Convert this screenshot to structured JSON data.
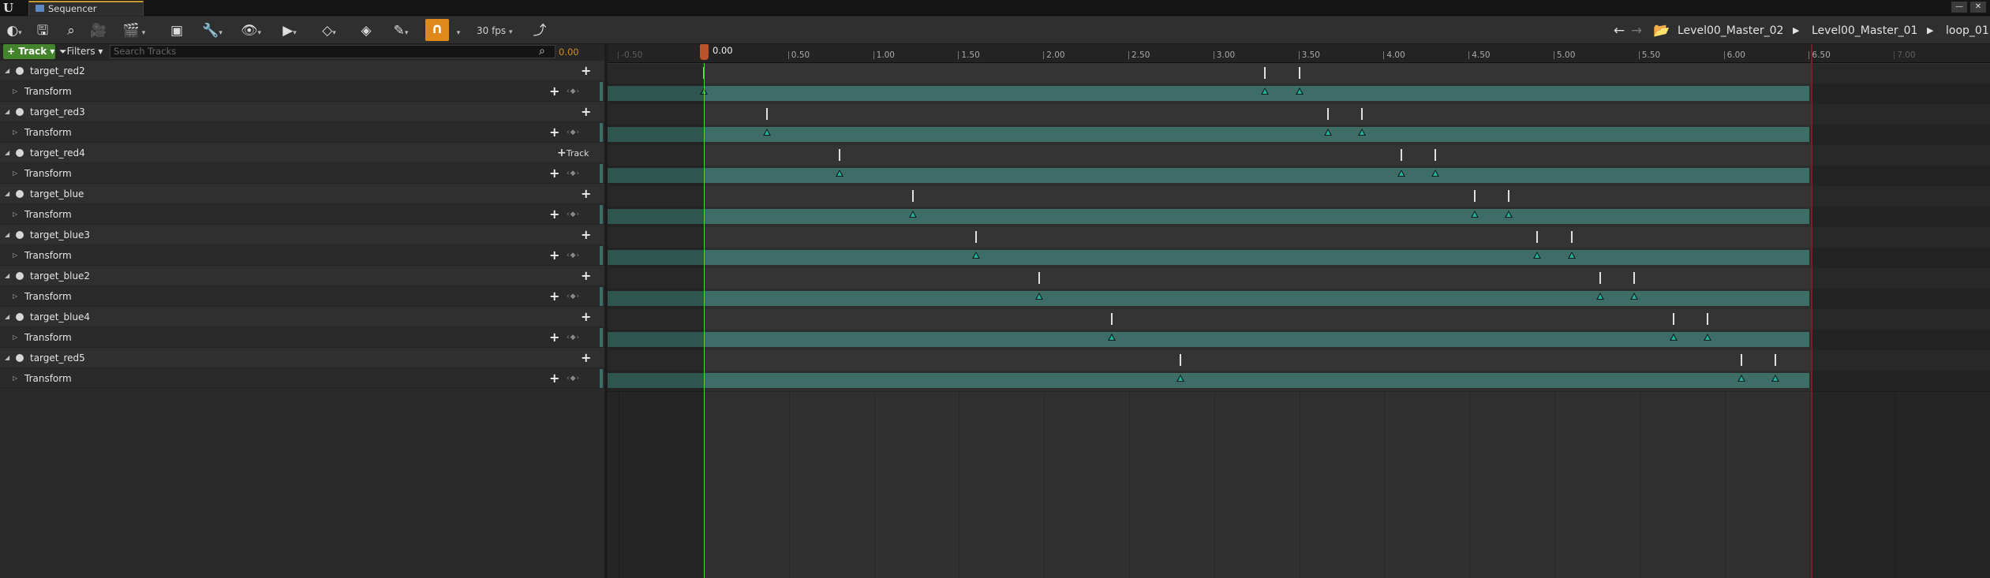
{
  "window": {
    "tab_title": "Sequencer",
    "min": "—",
    "close": "✕"
  },
  "toolbar": {
    "fps_label": "30 fps",
    "breadcrumbs": [
      "Level00_Master_02",
      "Level00_Master_01",
      "loop_01"
    ]
  },
  "filterbar": {
    "add_track": "Track",
    "filters": "Filters",
    "search_placeholder": "Search Tracks",
    "current_time": "0.00"
  },
  "tracks": [
    {
      "name": "target_red2",
      "child": "Transform",
      "action": ""
    },
    {
      "name": "target_red3",
      "child": "Transform",
      "action": ""
    },
    {
      "name": "target_red4",
      "child": "Transform",
      "action": "Track"
    },
    {
      "name": "target_blue",
      "child": "Transform",
      "action": ""
    },
    {
      "name": "target_blue3",
      "child": "Transform",
      "action": ""
    },
    {
      "name": "target_blue2",
      "child": "Transform",
      "action": ""
    },
    {
      "name": "target_blue4",
      "child": "Transform",
      "action": ""
    },
    {
      "name": "target_red5",
      "child": "Transform",
      "action": ""
    }
  ],
  "timeline": {
    "playhead_label": "0.00",
    "ticks": [
      "-0.50",
      "0.00",
      "0.50",
      "1.00",
      "1.50",
      "2.00",
      "2.50",
      "3.00",
      "3.50",
      "4.00",
      "4.50",
      "5.00",
      "5.50",
      "6.00",
      "6.50",
      "7.00"
    ],
    "end_time": 6.5,
    "keys": [
      [
        0.0,
        3.3,
        3.5
      ],
      [
        0.37,
        3.67,
        3.87
      ],
      [
        0.8,
        4.1,
        4.3
      ],
      [
        1.23,
        4.53,
        4.73
      ],
      [
        1.6,
        4.9,
        5.1
      ],
      [
        1.97,
        5.27,
        5.47
      ],
      [
        2.4,
        5.7,
        5.9
      ],
      [
        2.8,
        6.1,
        6.3
      ]
    ]
  },
  "colors": {
    "accent": "#e0891b",
    "section": "#3d6d66",
    "key": "#22b39f",
    "playhead": "#58d24b",
    "end_marker": "#7a1e1e"
  }
}
